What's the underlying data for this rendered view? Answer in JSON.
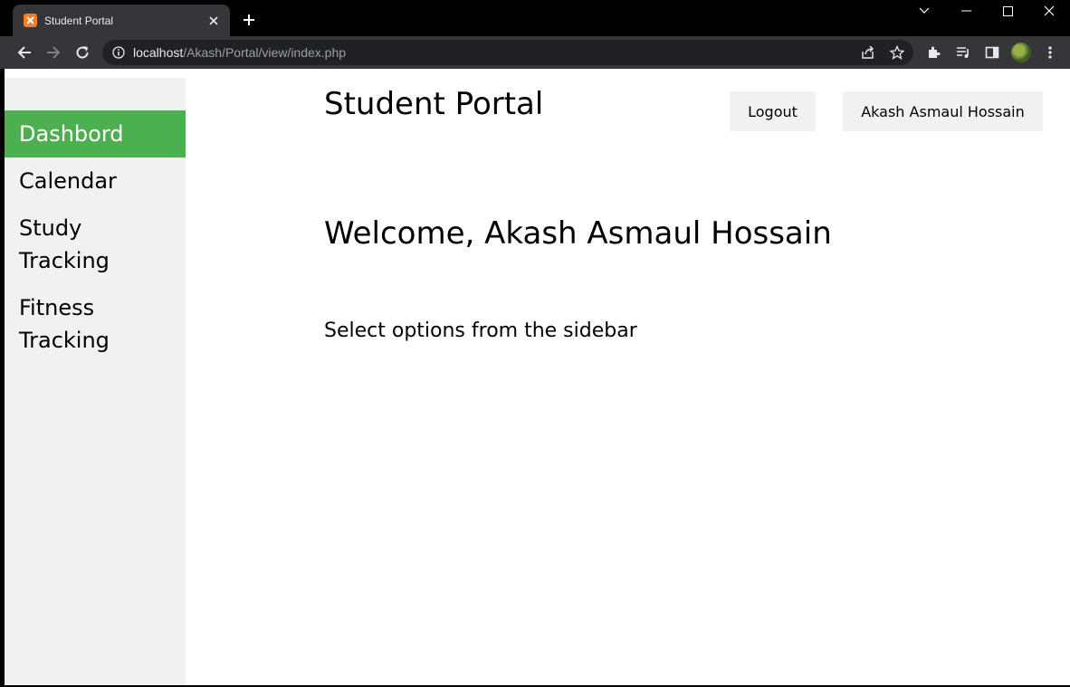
{
  "browser": {
    "tab_title": "Student Portal",
    "url_host": "localhost",
    "url_path": "/Akash/Portal/view/index.php",
    "favicon_color": "#fb7a24"
  },
  "header": {
    "title": "Student Portal",
    "logout_label": "Logout",
    "user_label": "Akash Asmaul Hossain"
  },
  "sidebar": {
    "accent_color": "#4caf50",
    "items": [
      {
        "label": "Dashbord",
        "active": true
      },
      {
        "label": "Calendar",
        "active": false
      },
      {
        "label": "Study Tracking",
        "active": false
      },
      {
        "label": "Fitness Tracking",
        "active": false
      }
    ]
  },
  "main": {
    "welcome": "Welcome, Akash Asmaul Hossain",
    "hint": "Select options from the sidebar"
  }
}
